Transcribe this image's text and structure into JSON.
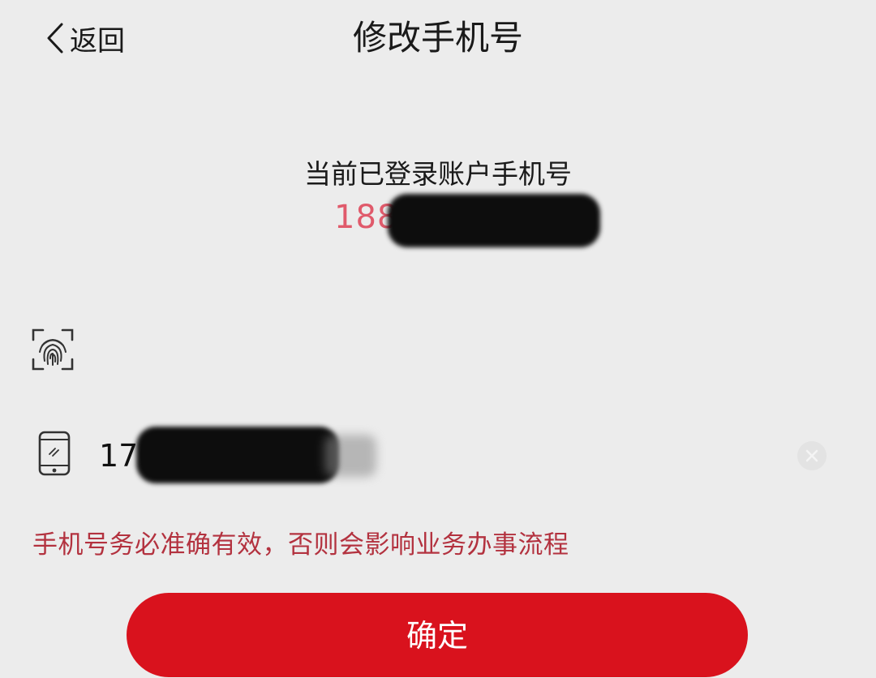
{
  "nav": {
    "back_label": "返回",
    "title": "修改手机号"
  },
  "current_account": {
    "label": "当前已登录账户手机号",
    "phone_visible_prefix": "188"
  },
  "verification": {
    "icon": "fingerprint-icon",
    "placeholder": ""
  },
  "new_phone": {
    "icon": "mobile-phone-icon",
    "value_visible_prefix": "1761"
  },
  "warning": {
    "text": "手机号务必准确有效，否则会影响业务办事流程"
  },
  "confirm": {
    "label": "确定"
  },
  "colors": {
    "background": "#ececec",
    "accent_red": "#d9121d",
    "warning_red": "#b3323f",
    "phone_pink": "#e05a6b"
  }
}
